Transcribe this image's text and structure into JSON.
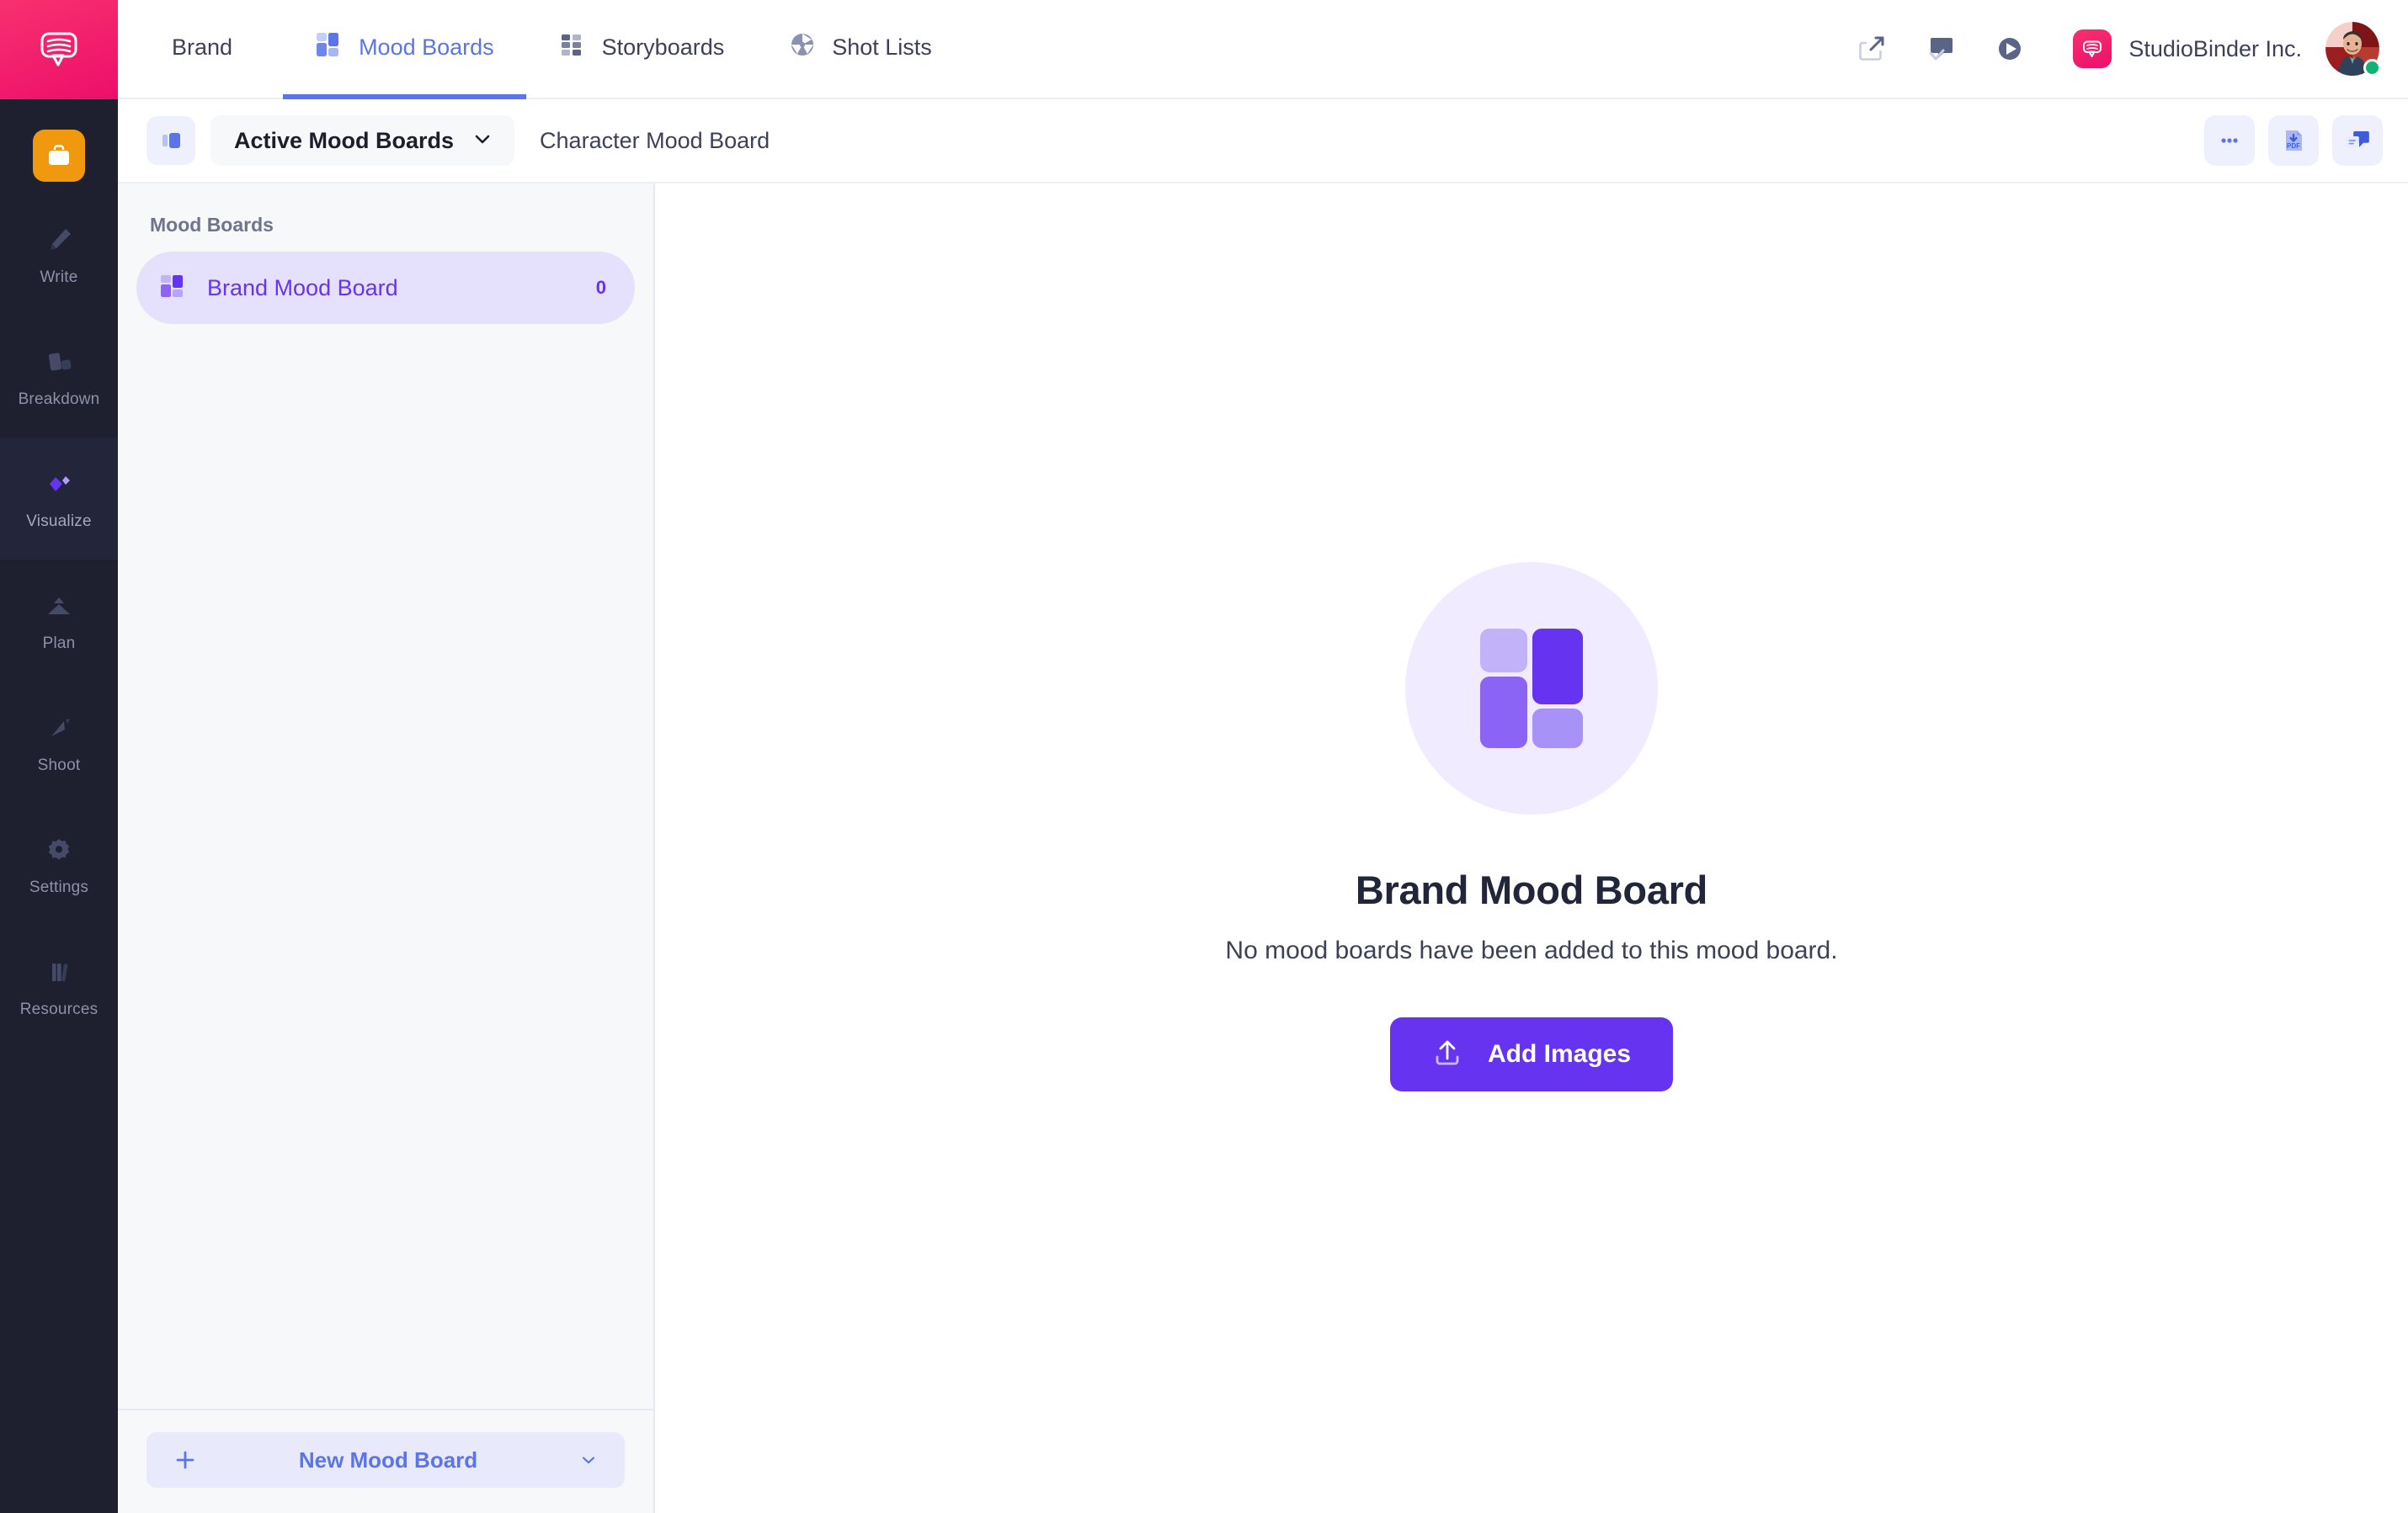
{
  "rail": {
    "logo_icon": "studiobinder-speech-bubble-logo",
    "app_tile_icon": "briefcase-icon",
    "items": [
      {
        "label": "Write",
        "icon": "pencil-icon",
        "active": false
      },
      {
        "label": "Breakdown",
        "icon": "cards-icon",
        "active": false
      },
      {
        "label": "Visualize",
        "icon": "diamonds-icon",
        "active": true
      },
      {
        "label": "Plan",
        "icon": "mountain-icon",
        "active": false
      },
      {
        "label": "Shoot",
        "icon": "clapper-icon",
        "active": false
      },
      {
        "label": "Settings",
        "icon": "gear-icon",
        "active": false
      },
      {
        "label": "Resources",
        "icon": "books-icon",
        "active": false
      }
    ]
  },
  "header": {
    "tabs": [
      {
        "label": "Brand",
        "icon": "",
        "active": false
      },
      {
        "label": "Mood Boards",
        "icon": "mosaic-icon",
        "active": true
      },
      {
        "label": "Storyboards",
        "icon": "grid-tiles-icon",
        "active": false
      },
      {
        "label": "Shot Lists",
        "icon": "aperture-icon",
        "active": false
      }
    ],
    "actions": [
      {
        "name": "share-icon"
      },
      {
        "name": "approve-comment-icon"
      },
      {
        "name": "play-circle-icon"
      }
    ],
    "company": "StudioBinder Inc.",
    "company_logo_icon": "studiobinder-mark",
    "avatar_icon": "user-avatar",
    "status": "online"
  },
  "subbar": {
    "panel_toggle_icon": "panel-toggle-icon",
    "filter_label": "Active Mood Boards",
    "filter_chevron_icon": "chevron-down-icon",
    "breadcrumb": "Character Mood Board",
    "actions": [
      {
        "name": "more-options-icon",
        "label": "..."
      },
      {
        "name": "download-pdf-icon",
        "label": "PDF"
      },
      {
        "name": "comments-icon",
        "label": ""
      }
    ]
  },
  "list_panel": {
    "section_title": "Mood Boards",
    "boards": [
      {
        "name": "Brand Mood Board",
        "count": "0",
        "icon": "mosaic-icon",
        "active": true
      }
    ],
    "new_button": {
      "label": "New Mood Board",
      "plus_icon": "plus-icon",
      "chevron_icon": "chevron-down-icon"
    }
  },
  "empty_state": {
    "icon": "mosaic-icon-large",
    "title": "Brand Mood Board",
    "subtitle": "No mood boards have been added to this mood board.",
    "button_label": "Add Images",
    "button_icon": "upload-icon"
  },
  "colors": {
    "accent_purple": "#6633f0",
    "accent_blue": "#5b74e8",
    "brand_pink": "#ec0f6a",
    "rail_dark": "#1e2030",
    "app_orange": "#f0990f",
    "status_green": "#12b273"
  }
}
